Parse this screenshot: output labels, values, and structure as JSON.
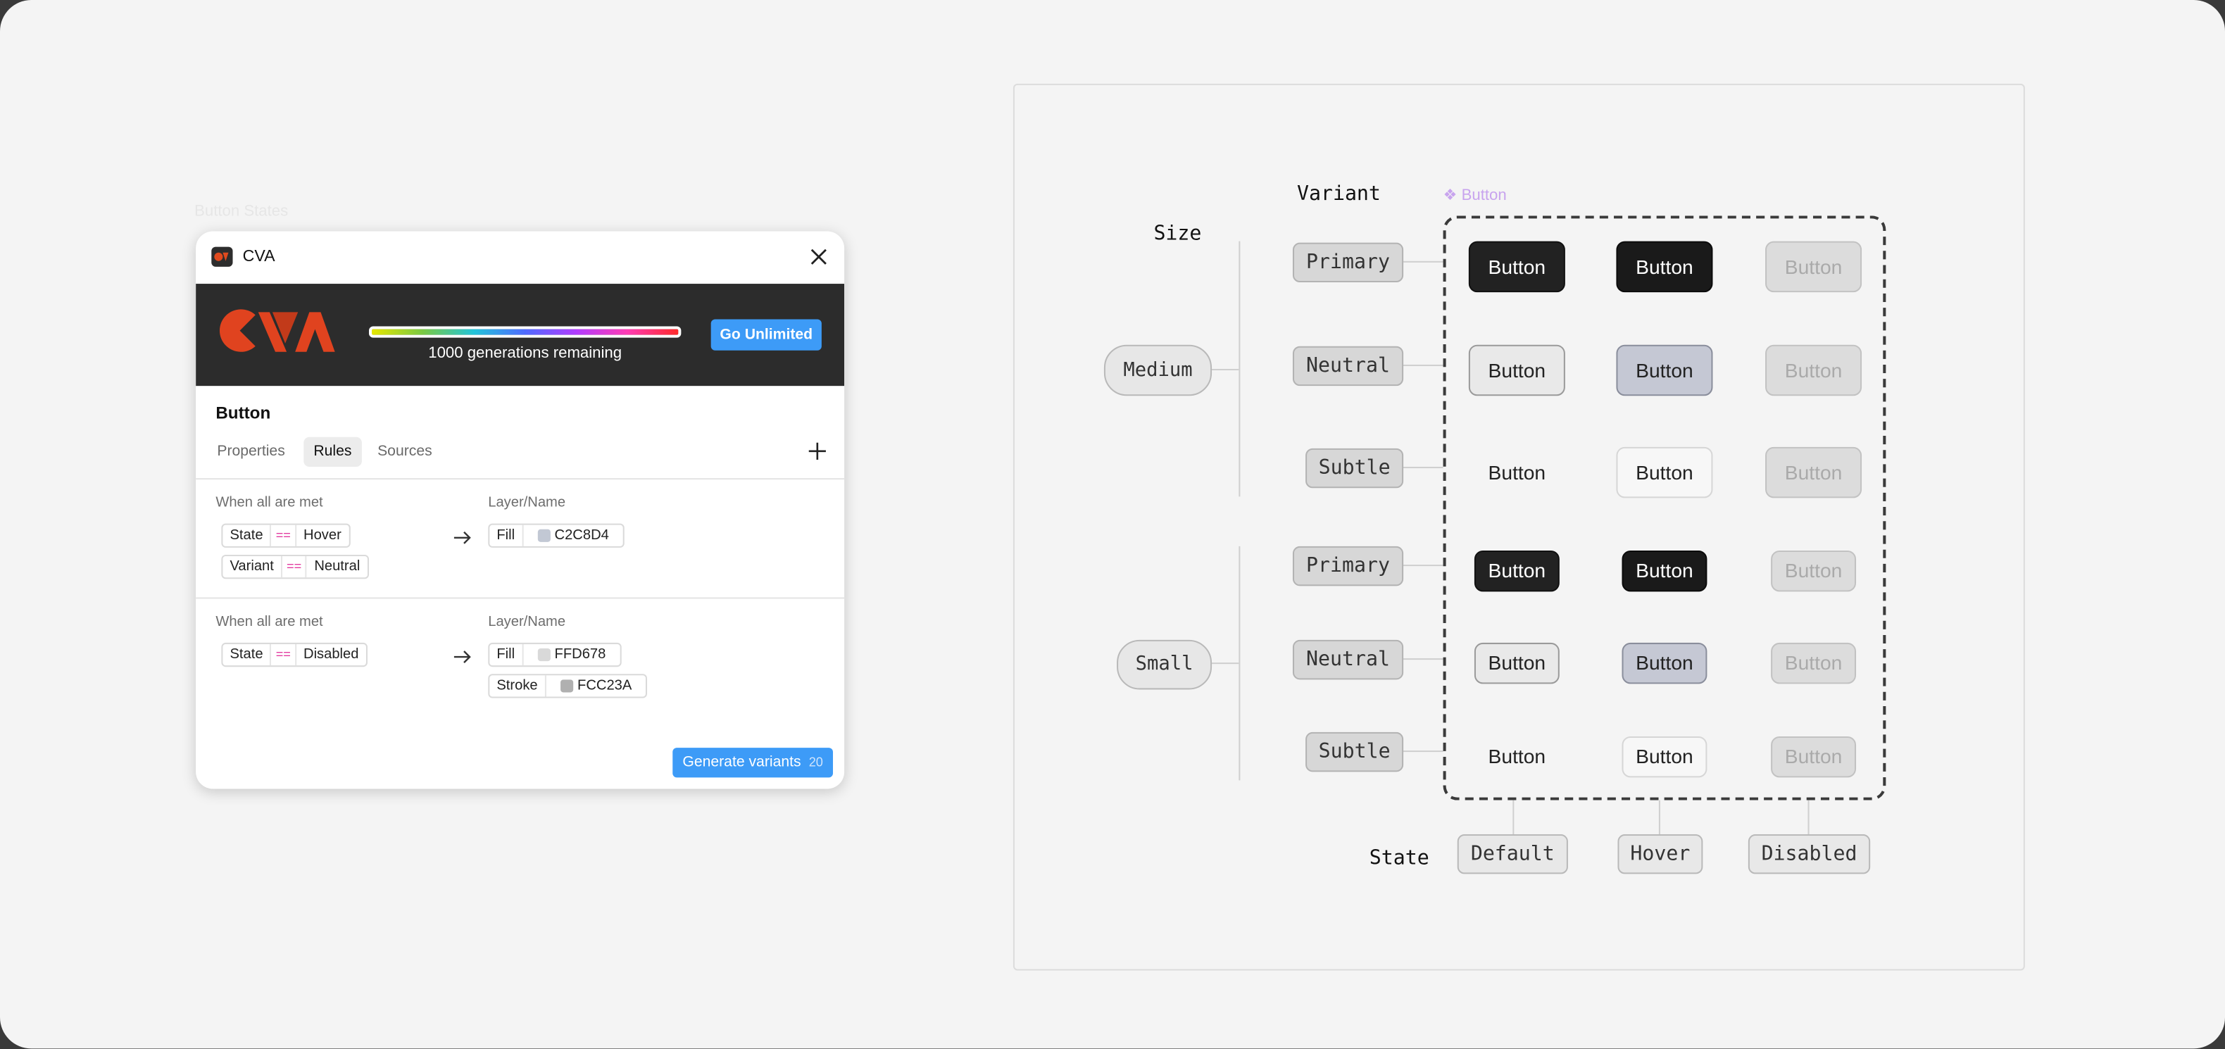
{
  "plugin": {
    "ghost_label": "Button States",
    "app_title": "CVA",
    "banner": {
      "generations_text": "1000 generations remaining",
      "go_unlimited_label": "Go Unlimited",
      "progress_fraction": 1.0
    },
    "component_name": "Button",
    "tabs": [
      "Properties",
      "Rules",
      "Sources"
    ],
    "active_tab": "Rules",
    "rules": [
      {
        "condition_label": "When all are met",
        "conditions": [
          {
            "prop": "State",
            "op": "==",
            "value": "Hover"
          },
          {
            "prop": "Variant",
            "op": "==",
            "value": "Neutral"
          }
        ],
        "target_label": "Layer/Name",
        "actions": [
          {
            "type": "Fill",
            "value": "C2C8D4",
            "color": "#C2C8D4"
          }
        ]
      },
      {
        "condition_label": "When all are met",
        "conditions": [
          {
            "prop": "State",
            "op": "==",
            "value": "Disabled"
          }
        ],
        "target_label": "Layer/Name",
        "actions": [
          {
            "type": "Fill",
            "value": "FFD678",
            "color": "#D9D9D9"
          },
          {
            "type": "Stroke",
            "value": "FCC23A",
            "color": "#B0B0B0"
          }
        ]
      }
    ],
    "generate_label": "Generate variants",
    "generate_count": "20",
    "colors": {
      "accent": "#3D9BF7",
      "banner_bg": "#2C2C2C",
      "operator": "#E23AA0"
    }
  },
  "canvas": {
    "variant_title": "Variant",
    "size_title": "Size",
    "state_title": "State",
    "component_label": "❖ Button",
    "sizes": [
      "Medium",
      "Small"
    ],
    "variants": [
      "Primary",
      "Neutral",
      "Subtle"
    ],
    "states": [
      "Default",
      "Hover",
      "Disabled"
    ],
    "button_label": "Button"
  }
}
